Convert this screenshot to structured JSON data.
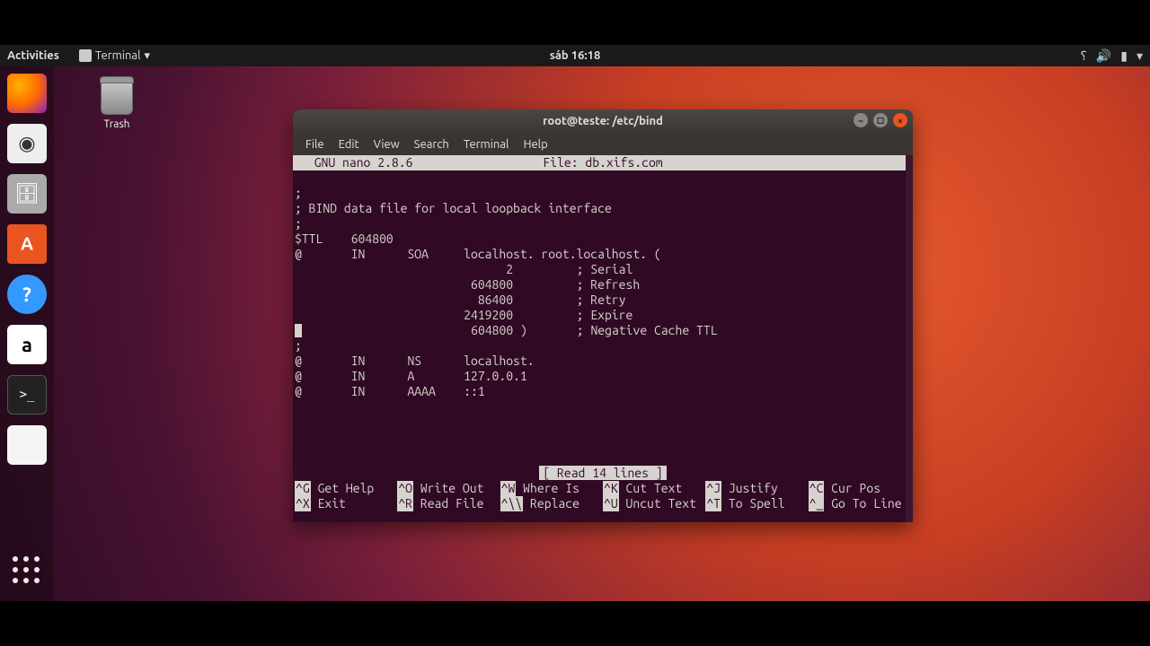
{
  "topbar": {
    "activities": "Activities",
    "app_label": "Terminal",
    "clock": "sáb 16:18"
  },
  "desktop": {
    "trash_label": "Trash"
  },
  "dock": {
    "items": [
      "firefox",
      "rhythm",
      "files",
      "software",
      "help",
      "amazon",
      "terminal",
      "libre"
    ]
  },
  "terminal": {
    "title": "root@teste: /etc/bind",
    "menubar": [
      "File",
      "Edit",
      "View",
      "Search",
      "Terminal",
      "Help"
    ],
    "nano": {
      "version": "  GNU nano 2.8.6",
      "file_label": "File: db.xifs.com",
      "status": "[ Read 14 lines ]",
      "content_lines": [
        ";",
        "; BIND data file for local loopback interface",
        ";",
        "$TTL    604800",
        "@       IN      SOA     localhost. root.localhost. (",
        "                              2         ; Serial",
        "                         604800         ; Refresh",
        "                          86400         ; Retry",
        "                        2419200         ; Expire",
        "                         604800 )       ; Negative Cache TTL",
        ";",
        "@       IN      NS      localhost.",
        "@       IN      A       127.0.0.1",
        "@       IN      AAAA    ::1"
      ],
      "shortcuts": [
        {
          "key": "^G",
          "label": "Get Help"
        },
        {
          "key": "^O",
          "label": "Write Out"
        },
        {
          "key": "^W",
          "label": "Where Is"
        },
        {
          "key": "^K",
          "label": "Cut Text"
        },
        {
          "key": "^J",
          "label": "Justify"
        },
        {
          "key": "^C",
          "label": "Cur Pos"
        },
        {
          "key": "^X",
          "label": "Exit"
        },
        {
          "key": "^R",
          "label": "Read File"
        },
        {
          "key": "^\\\\",
          "label": "Replace"
        },
        {
          "key": "^U",
          "label": "Uncut Text"
        },
        {
          "key": "^T",
          "label": "To Spell"
        },
        {
          "key": "^_",
          "label": "Go To Line"
        }
      ]
    }
  }
}
